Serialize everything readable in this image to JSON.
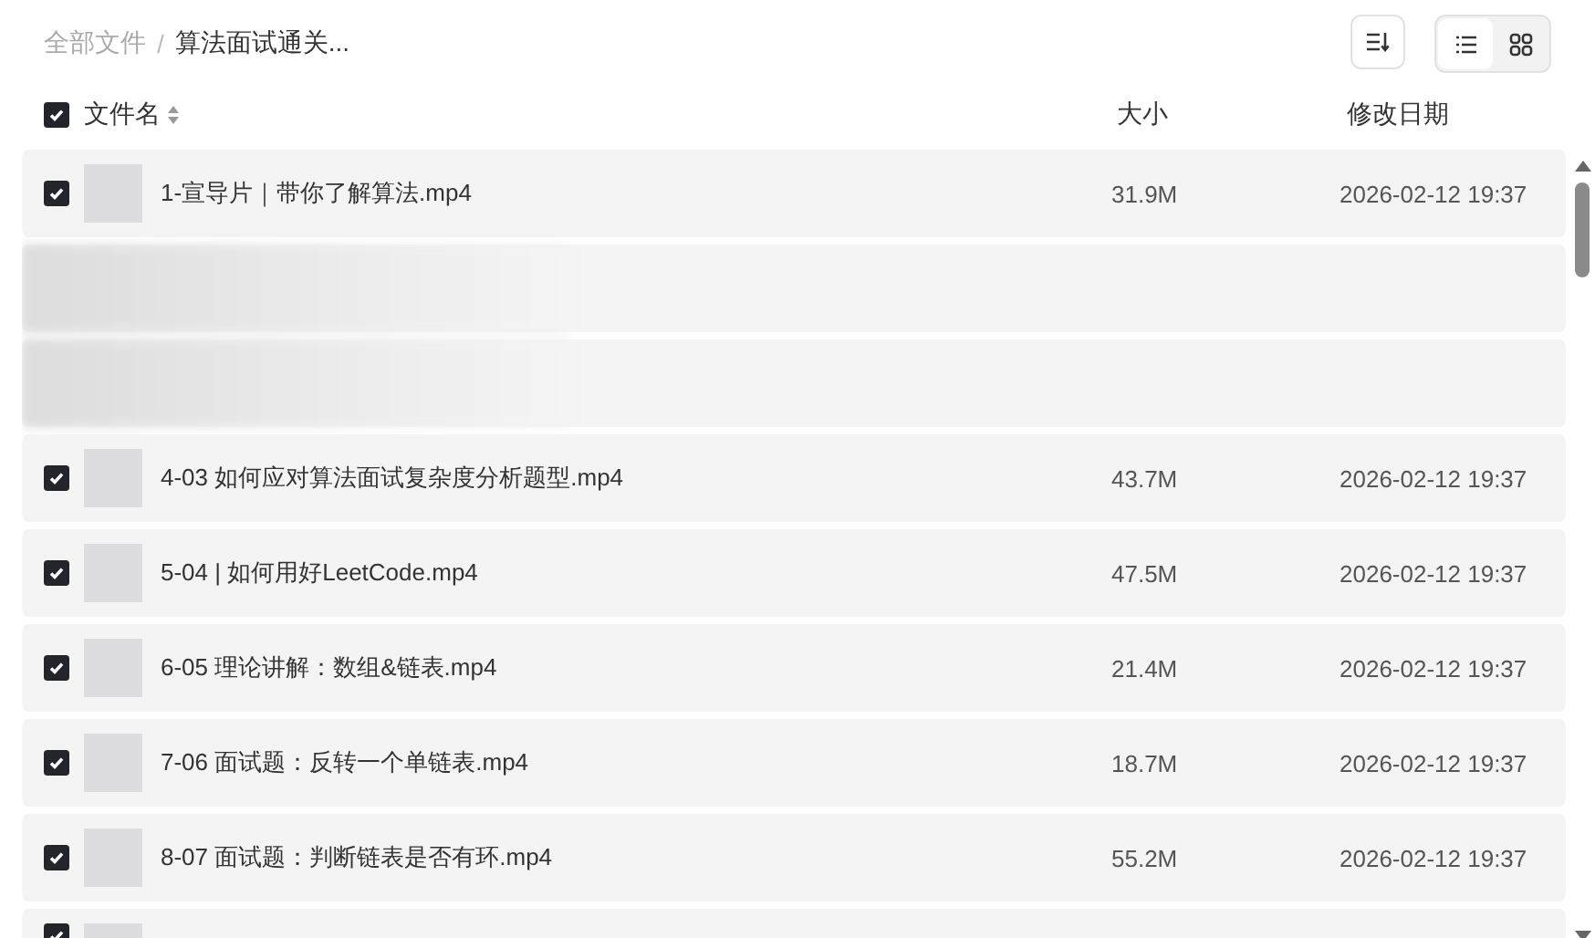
{
  "breadcrumb": [
    {
      "label": "全部文件",
      "current": false
    },
    {
      "label": "算法面试通关...",
      "current": true
    }
  ],
  "breadcrumb_separator": "/",
  "view_toggle": [
    {
      "kind": "list",
      "selected": true
    },
    {
      "kind": "grid",
      "selected": false
    }
  ],
  "header": {
    "checked": true,
    "name": "文件名",
    "size": "大小",
    "date": "修改日期"
  },
  "rows": [
    {
      "kind": "file",
      "checked": true,
      "name": "1-宣导片｜带你了解算法.mp4",
      "size": "31.9M",
      "date": "2026-02-12 19:37"
    },
    {
      "kind": "obscured"
    },
    {
      "kind": "obscured"
    },
    {
      "kind": "file",
      "checked": true,
      "name": "4-03 如何应对算法面试复杂度分析题型.mp4",
      "size": "43.7M",
      "date": "2026-02-12 19:37"
    },
    {
      "kind": "file",
      "checked": true,
      "name": "5-04 | 如何用好LeetCode.mp4",
      "size": "47.5M",
      "date": "2026-02-12 19:37"
    },
    {
      "kind": "file",
      "checked": true,
      "name": "6-05 理论讲解：数组&链表.mp4",
      "size": "21.4M",
      "date": "2026-02-12 19:37"
    },
    {
      "kind": "file",
      "checked": true,
      "name": "7-06 面试题：反转一个单链表.mp4",
      "size": "18.7M",
      "date": "2026-02-12 19:37"
    },
    {
      "kind": "file",
      "checked": true,
      "name": "8-07 面试题：判断链表是否有环.mp4",
      "size": "55.2M",
      "date": "2026-02-12 19:37"
    },
    {
      "kind": "file",
      "checked": true
    }
  ]
}
